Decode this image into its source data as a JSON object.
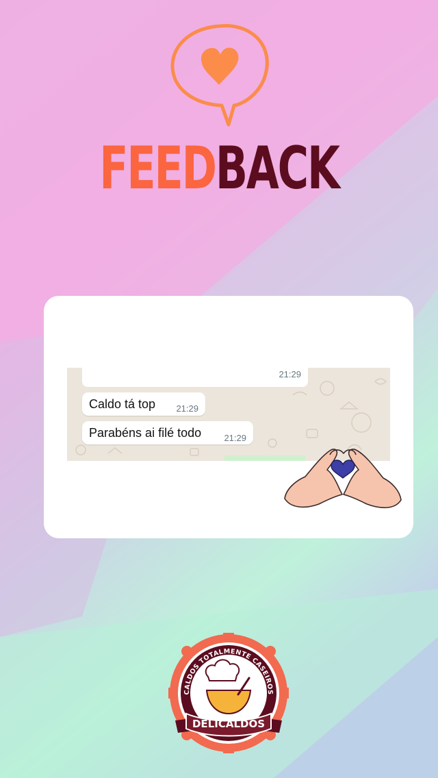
{
  "header": {
    "icon": "heart-speech-bubble-icon",
    "title_part1": "FEED",
    "title_part2": "BACK"
  },
  "chat": {
    "top_time": "21:29",
    "messages": [
      {
        "text": "Caldo tá top",
        "time": "21:29"
      },
      {
        "text": "Parabéns ai filé todo",
        "time": "21:29"
      }
    ]
  },
  "decoration": {
    "hands_icon": "heart-hands-icon"
  },
  "logo": {
    "arc_text": "CALDOS TOTALMENTE CASEIROS",
    "brand": "DELICALDOS"
  },
  "colors": {
    "accent_orange": "#fb6540",
    "accent_wine": "#5b0d1f",
    "background_pink": "#f1a9e3",
    "background_mint": "#b5f2d8"
  }
}
